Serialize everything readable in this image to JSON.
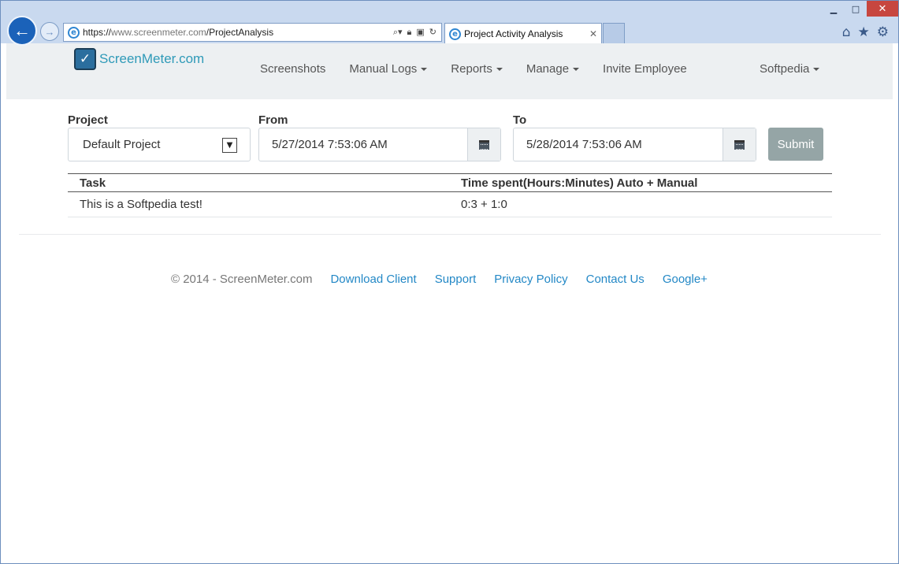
{
  "browser": {
    "address": {
      "scheme": "https://",
      "host": "www.screenmeter.com",
      "path": "/ProjectAnalysis"
    },
    "tab_title": "Project Activity Analysis",
    "icons": [
      "back-arrow-icon",
      "forward-arrow-icon",
      "ie-logo-icon",
      "search-icon",
      "lock-icon",
      "compat-view-icon",
      "refresh-icon",
      "close-icon",
      "home-icon",
      "star-icon",
      "gear-icon"
    ]
  },
  "site": {
    "brand": "ScreenMeter.com",
    "nav": {
      "screenshots": "Screenshots",
      "manual_logs": "Manual Logs",
      "reports": "Reports",
      "manage": "Manage",
      "invite_employee": "Invite Employee",
      "user": "Softpedia"
    }
  },
  "form": {
    "project_label": "Project",
    "project_value": "Default Project",
    "from_label": "From",
    "from_value": "5/27/2014 7:53:06 AM",
    "to_label": "To",
    "to_value": "5/28/2014 7:53:06 AM",
    "submit": "Submit"
  },
  "table": {
    "headers": [
      "Task",
      "Time spent(Hours:Minutes) Auto + Manual"
    ],
    "rows": [
      [
        "This is a Softpedia test!",
        "0:3 + 1:0"
      ]
    ]
  },
  "footer": {
    "copyright": "© 2014 - ScreenMeter.com",
    "links": [
      "Download Client",
      "Support",
      "Privacy Policy",
      "Contact Us",
      "Google+"
    ]
  }
}
